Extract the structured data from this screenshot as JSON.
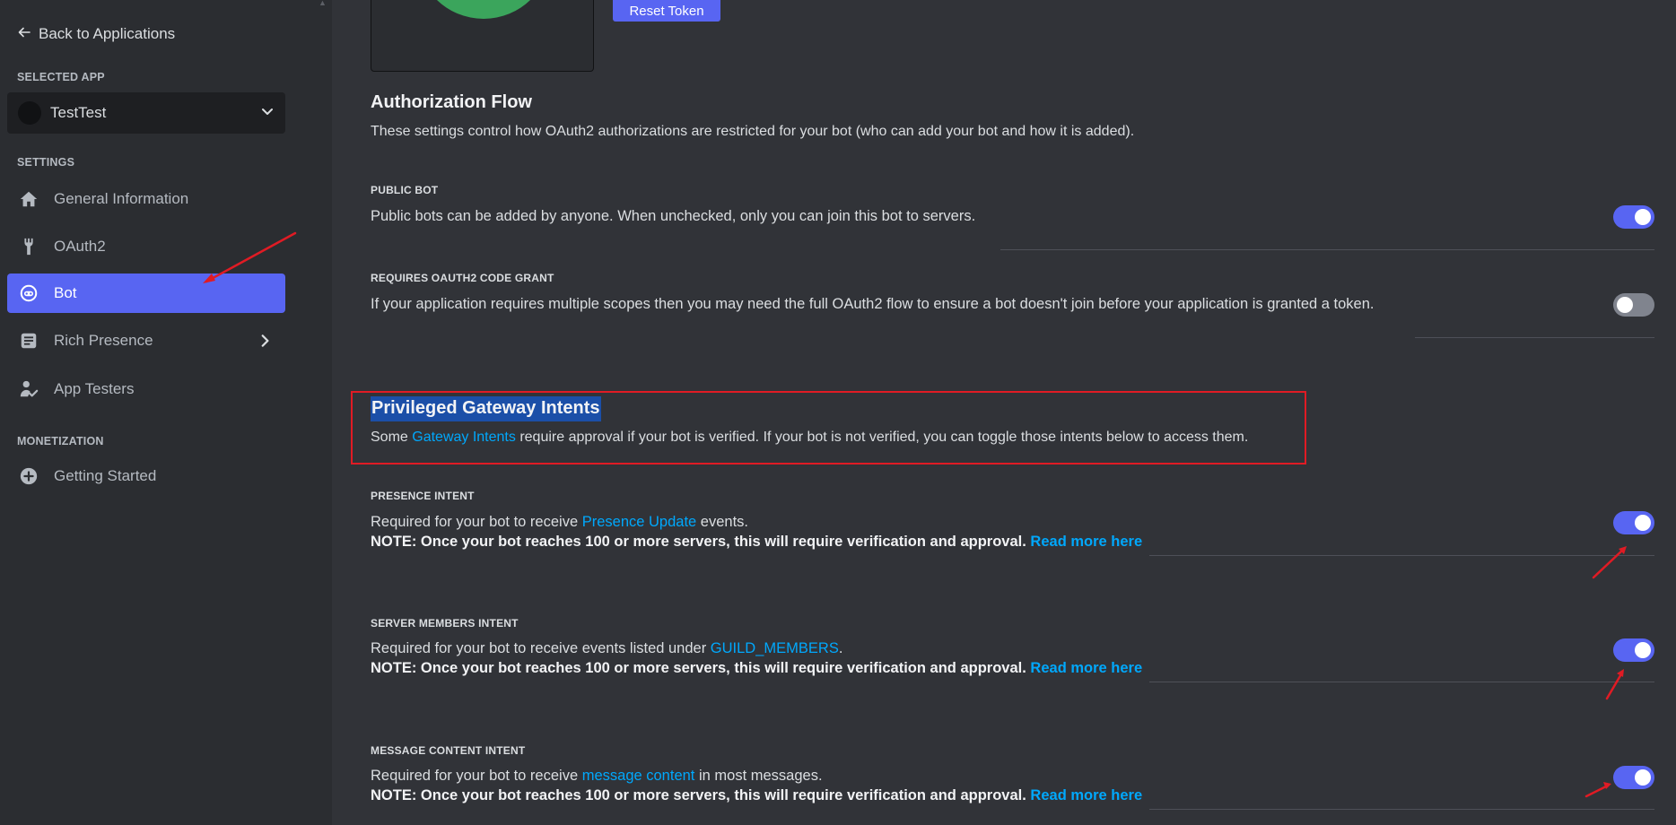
{
  "sidebar": {
    "back_label": "Back to Applications",
    "selected_app_label": "SELECTED APP",
    "selected_app_name": "TestTest",
    "settings_label": "SETTINGS",
    "items": [
      {
        "label": "General Information",
        "icon": "home-icon"
      },
      {
        "label": "OAuth2",
        "icon": "wrench-icon"
      },
      {
        "label": "Bot",
        "icon": "robot-icon",
        "active": true
      },
      {
        "label": "Rich Presence",
        "icon": "document-icon"
      },
      {
        "label": "App Testers",
        "icon": "person-check-icon"
      }
    ],
    "monetization_label": "MONETIZATION",
    "monetization_items": [
      {
        "label": "Getting Started",
        "icon": "plus-circle-icon"
      }
    ]
  },
  "main": {
    "reset_token_label": "Reset Token",
    "auth_flow": {
      "title": "Authorization Flow",
      "description": "These settings control how OAuth2 authorizations are restricted for your bot (who can add your bot and how it is added).",
      "public_bot": {
        "label": "PUBLIC BOT",
        "text": "Public bots can be added by anyone. When unchecked, only you can join this bot to servers.",
        "enabled": true
      },
      "code_grant": {
        "label": "REQUIRES OAUTH2 CODE GRANT",
        "text": "If your application requires multiple scopes then you may need the full OAuth2 flow to ensure a bot doesn't join before your application is granted a token.",
        "enabled": false
      }
    },
    "intents": {
      "title": "Privileged Gateway Intents",
      "desc_before": "Some ",
      "desc_link": "Gateway Intents",
      "desc_after": " require approval if your bot is verified. If your bot is not verified, you can toggle those intents below to access them.",
      "note": "NOTE: Once your bot reaches 100 or more servers, this will require verification and approval.",
      "read_more": "Read more here",
      "presence": {
        "label": "PRESENCE INTENT",
        "text_before": "Required for your bot to receive ",
        "link": "Presence Update",
        "text_after": " events.",
        "enabled": true
      },
      "server_members": {
        "label": "SERVER MEMBERS INTENT",
        "text_before": "Required for your bot to receive events listed under ",
        "link": "GUILD_MEMBERS",
        "text_after": ".",
        "enabled": true
      },
      "message_content": {
        "label": "MESSAGE CONTENT INTENT",
        "text_before": "Required for your bot to receive ",
        "link": "message content",
        "text_after": " in most messages.",
        "enabled": true
      }
    }
  },
  "colors": {
    "accent": "#5865f2",
    "link": "#00a8fc",
    "annotation_red": "#e01b24",
    "sidebar_bg": "#2b2d31",
    "main_bg": "#313338"
  }
}
